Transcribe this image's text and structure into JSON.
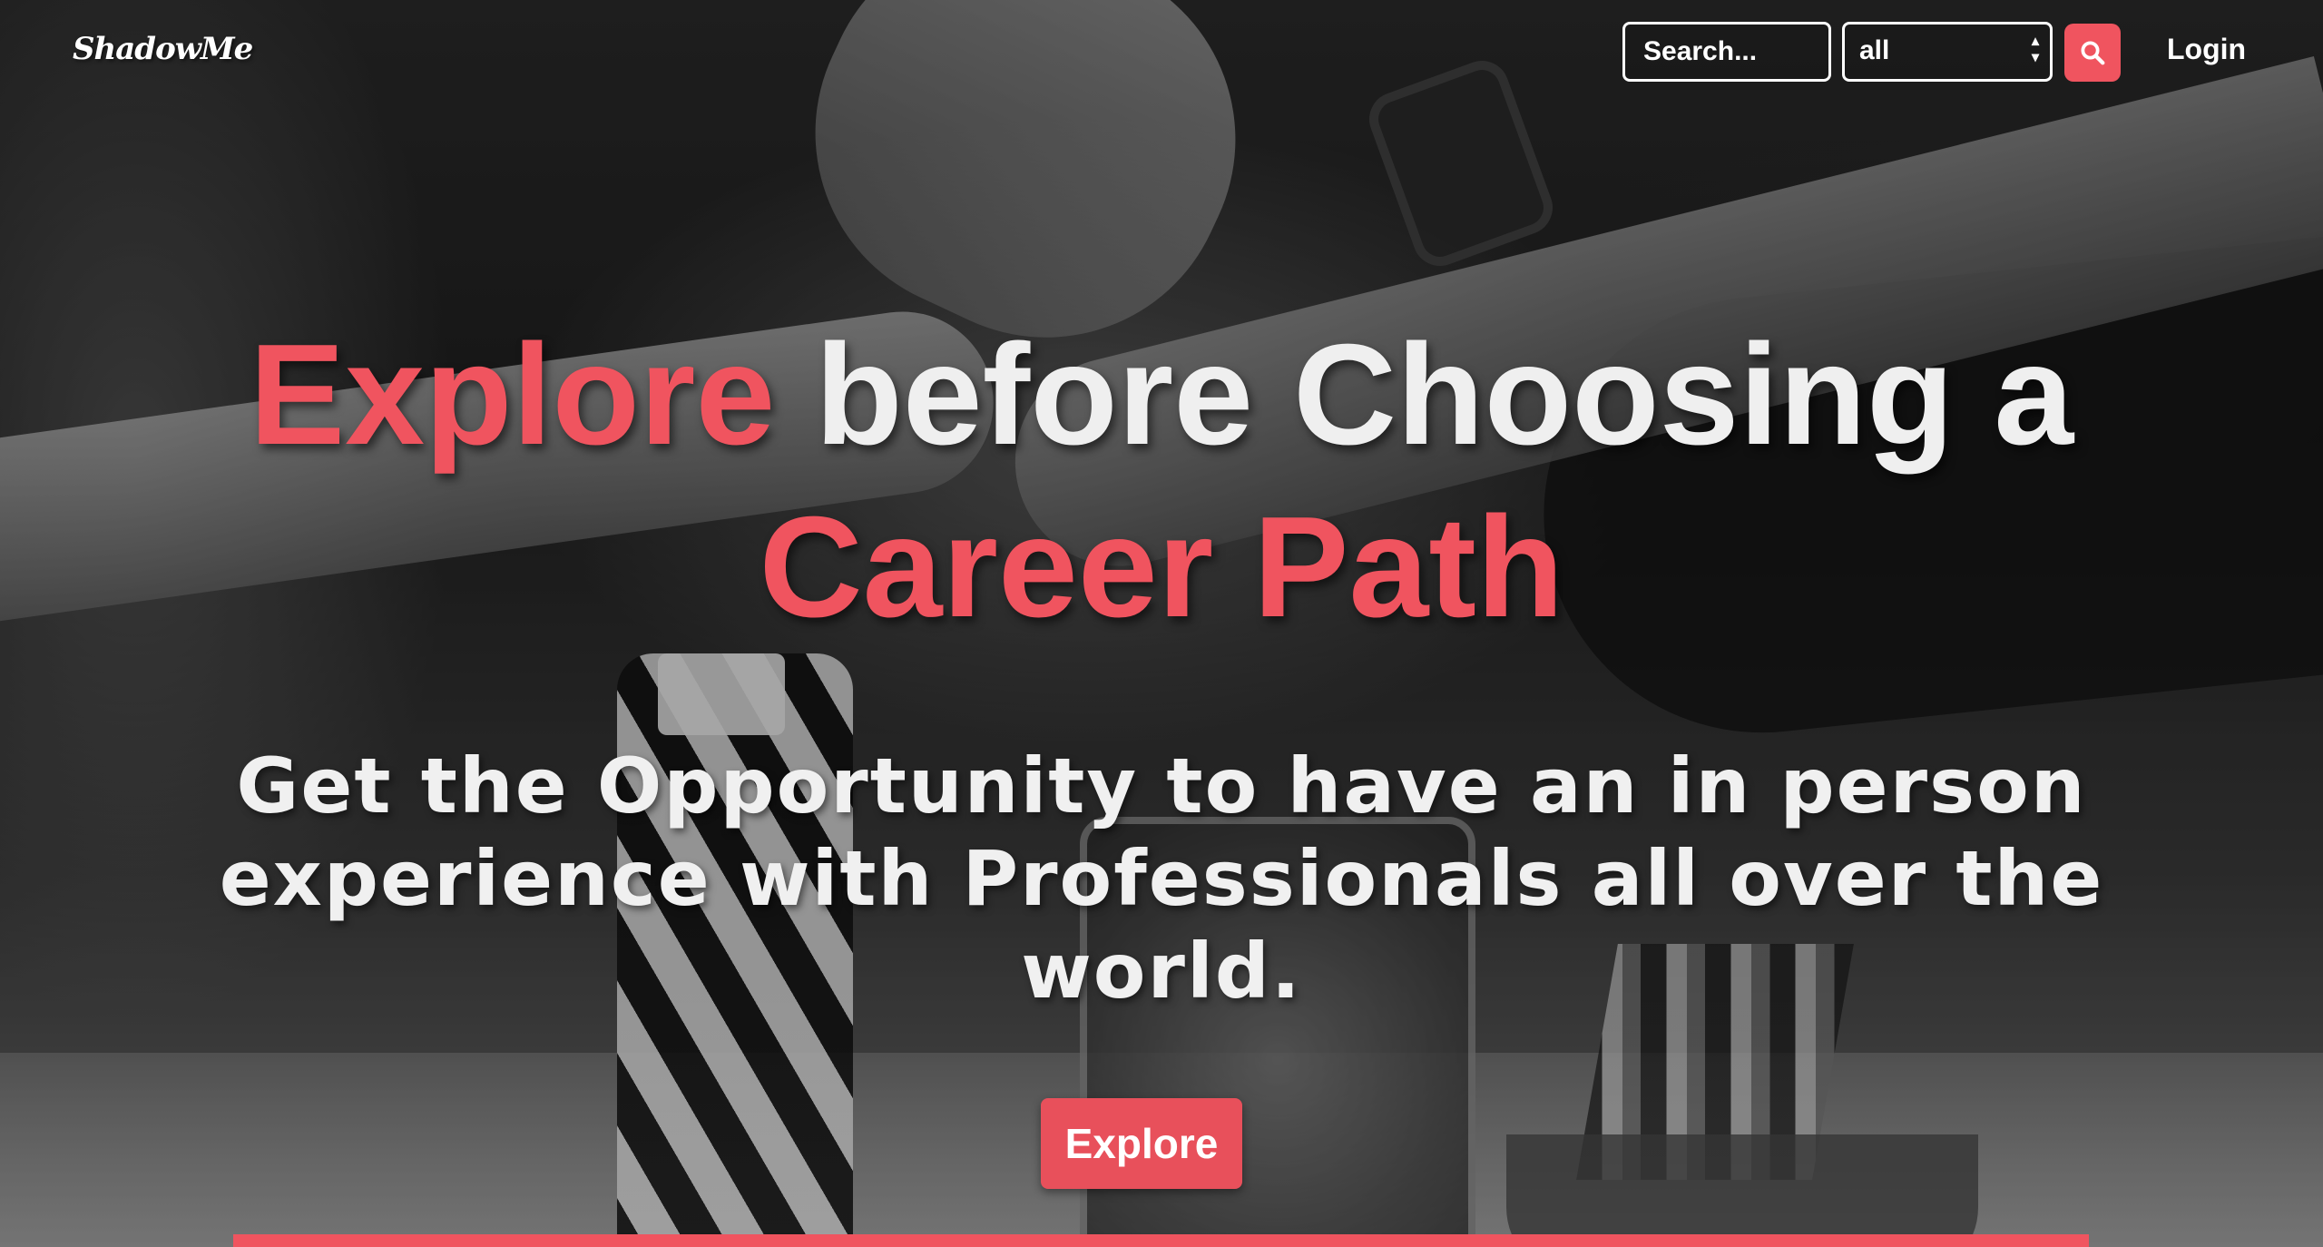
{
  "navbar": {
    "brand": "ShadowMe",
    "search_placeholder": "Search...",
    "category_selected": "all",
    "search_button_icon": "search-icon",
    "login_label": "Login"
  },
  "hero": {
    "headline_accent_1": "Explore",
    "headline_rest": " before Choosing a ",
    "headline_accent_2": "Career Path",
    "subheadline": "Get the Opportunity to have an in person experience with Professionals all over the world.",
    "cta_label": "Explore"
  },
  "colors": {
    "accent": "#f0545f",
    "text_light": "#efefef"
  }
}
